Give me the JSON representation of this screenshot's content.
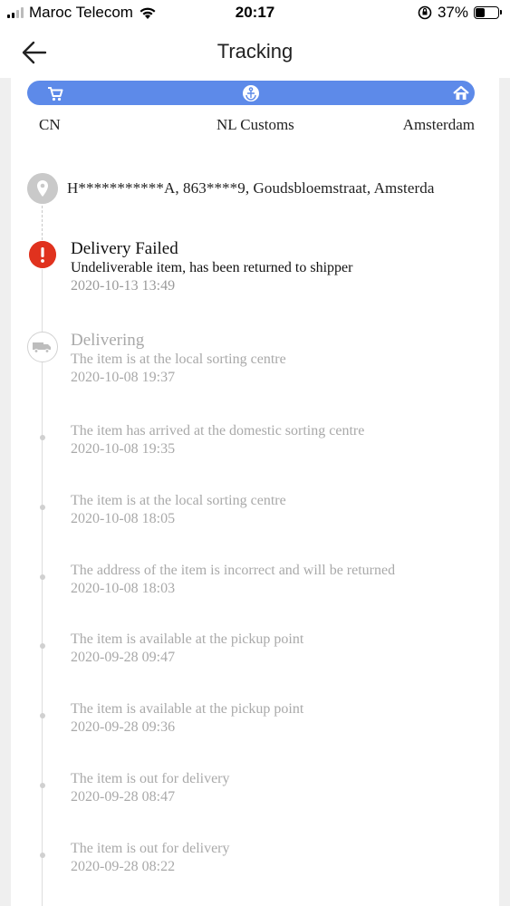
{
  "status_bar": {
    "carrier": "Maroc Telecom",
    "time": "20:17",
    "battery": "37%"
  },
  "nav": {
    "title": "Tracking",
    "back_icon": "arrow-left-icon"
  },
  "route": {
    "accent": "#5d8ae9",
    "stops": [
      {
        "label": "CN",
        "icon": "cart-icon"
      },
      {
        "label": "NL Customs",
        "icon": "customs-icon"
      },
      {
        "label": "Amsterdam",
        "icon": "home-icon"
      }
    ]
  },
  "address": {
    "icon": "location-pin-icon",
    "text": "H***********A,  863****9,  Goudsbloemstraat,  Amsterda"
  },
  "events": [
    {
      "status": "Delivery Failed",
      "description": "Undeliverable item, has been returned to shipper",
      "time": "2020-10-13 13:49",
      "icon": "alert-icon"
    },
    {
      "status": "Delivering",
      "description": "The item is at the local sorting centre",
      "time": "2020-10-08 19:37",
      "icon": "truck-icon"
    },
    {
      "description": "The item has arrived at the domestic sorting centre",
      "time": "2020-10-08 19:35"
    },
    {
      "description": "The item is at the local sorting centre",
      "time": "2020-10-08 18:05"
    },
    {
      "description": "The address of the item is incorrect and will be returned",
      "time": "2020-10-08 18:03"
    },
    {
      "description": "The item is available at the pickup point",
      "time": "2020-09-28 09:47"
    },
    {
      "description": "The item is available at the pickup point",
      "time": "2020-09-28 09:36"
    },
    {
      "description": "The item is out for delivery",
      "time": "2020-09-28 08:47"
    },
    {
      "description": "The item is out for delivery",
      "time": "2020-09-28 08:22"
    }
  ]
}
